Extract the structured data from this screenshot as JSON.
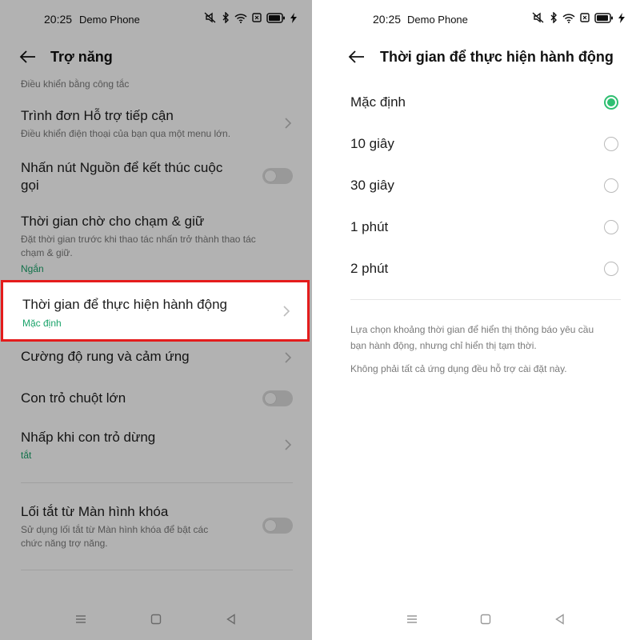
{
  "status_bar": {
    "time": "20:25",
    "carrier": "Demo Phone",
    "icons": [
      "mute-icon",
      "bluetooth-icon",
      "wifi-icon",
      "sim-icon",
      "battery-icon",
      "charging-icon"
    ]
  },
  "left_screen": {
    "title": "Trợ năng",
    "partial_top_text": "Điều khiển bằng công tắc",
    "items": [
      {
        "title": "Trình đơn Hỗ trợ tiếp cận",
        "subtitle": "Điều khiển điện thoại của bạn qua một menu lớn.",
        "control": "chevron"
      },
      {
        "title": "Nhấn nút Nguồn để kết thúc cuộc",
        "title2": "gọi",
        "control": "toggle",
        "state": false
      },
      {
        "title": "Thời gian chờ cho chạm & giữ",
        "subtitle": "Đặt thời gian trước khi thao tác nhấn trở thành thao tác",
        "subtitle2": "chạm & giữ.",
        "value": "Ngắn",
        "control": "none"
      },
      {
        "title": "Thời gian để thực hiện hành động",
        "value": "Mặc định",
        "control": "chevron",
        "highlighted": true
      },
      {
        "title": "Cường độ rung và cảm ứng",
        "control": "chevron"
      },
      {
        "title": "Con trỏ chuột lớn",
        "control": "toggle",
        "state": false
      },
      {
        "title": "Nhấp khi con trỏ dừng",
        "value": "tắt",
        "control": "chevron"
      },
      {
        "title": "Lối tắt từ Màn hình khóa",
        "subtitle": "Sử dụng lối tắt từ Màn hình khóa để bật các",
        "subtitle2": "chức năng trợ năng.",
        "control": "toggle",
        "state": false
      }
    ]
  },
  "right_screen": {
    "title": "Thời gian để thực hiện hành động",
    "options": [
      {
        "label": "Mặc định",
        "selected": true
      },
      {
        "label": "10 giây",
        "selected": false
      },
      {
        "label": "30 giây",
        "selected": false
      },
      {
        "label": "1 phút",
        "selected": false
      },
      {
        "label": "2 phút",
        "selected": false
      }
    ],
    "description1": "Lựa chọn khoảng thời gian để hiển thị thông báo yêu cầu",
    "description1b": "bạn hành động, nhưng chỉ hiển thị tạm thời.",
    "description2": "Không phải tất cả ứng dụng đều hỗ trợ cài đặt này."
  },
  "colors": {
    "accent": "#2fbf71",
    "value_green": "#1aa36a",
    "highlight_border": "#e41c1c"
  }
}
